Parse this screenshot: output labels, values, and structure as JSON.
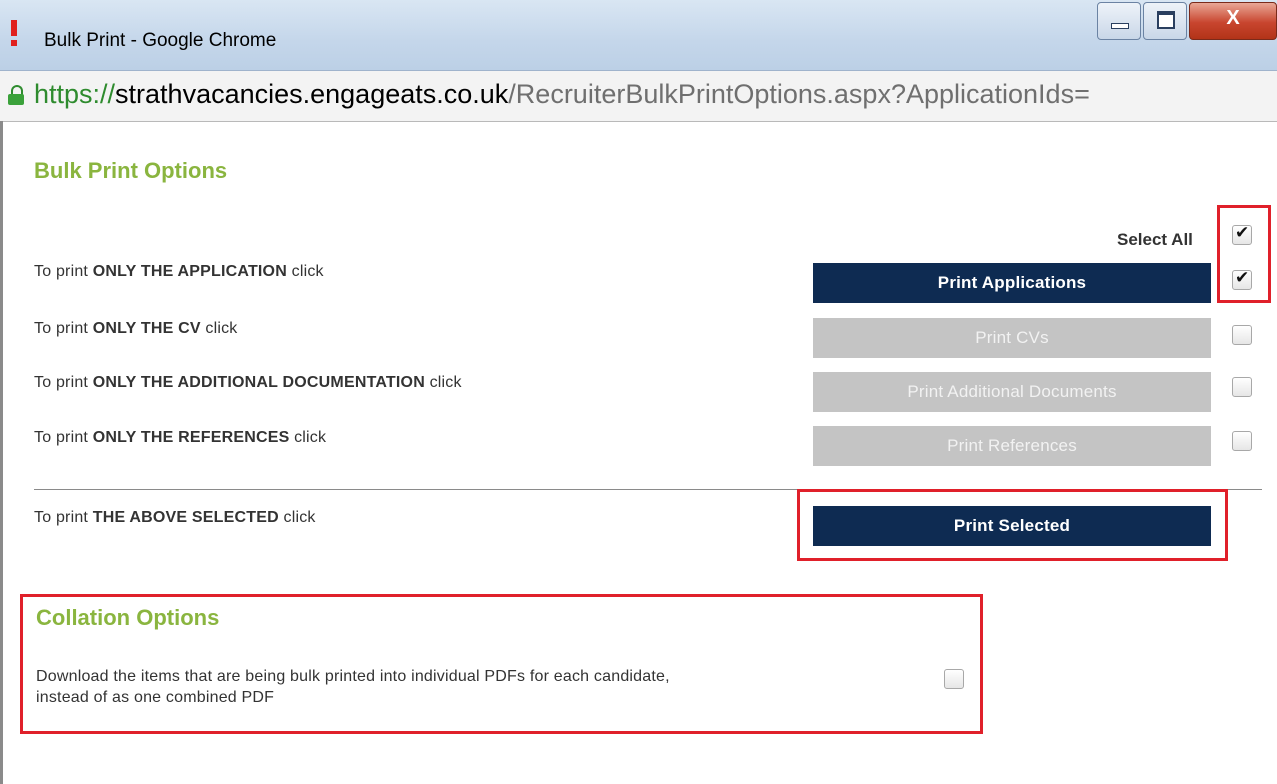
{
  "window": {
    "title": "Bulk Print - Google Chrome",
    "close_label": "X"
  },
  "address": {
    "protocol": "https://",
    "host": "strathvacancies.engageats.co.uk",
    "path": "/RecruiterBulkPrintOptions.aspx?ApplicationIds="
  },
  "colors": {
    "accent_green": "#8ab53f",
    "button_navy": "#0e2b52",
    "button_disabled": "#c4c4c4",
    "highlight_red": "#e0202a"
  },
  "bulk_print": {
    "heading": "Bulk Print Options",
    "select_all_label": "Select All",
    "select_all_checked": true,
    "rows": [
      {
        "prefix": "To print ",
        "strong": "ONLY THE APPLICATION",
        "suffix": " click",
        "button": "Print Applications",
        "enabled": true,
        "checked": true
      },
      {
        "prefix": "To print ",
        "strong": "ONLY THE CV",
        "suffix": " click",
        "button": "Print CVs",
        "enabled": false,
        "checked": false
      },
      {
        "prefix": "To print ",
        "strong": "ONLY THE ADDITIONAL DOCUMENTATION",
        "suffix": " click",
        "button": "Print Additional Documents",
        "enabled": false,
        "checked": false
      },
      {
        "prefix": "To print ",
        "strong": "ONLY THE REFERENCES",
        "suffix": " click",
        "button": "Print References",
        "enabled": false,
        "checked": false
      }
    ],
    "selected_row": {
      "prefix": "To print ",
      "strong": "THE ABOVE SELECTED",
      "suffix": " click",
      "button": "Print Selected"
    }
  },
  "collation": {
    "heading": "Collation Options",
    "line1": "Download the items that are being bulk printed into individual PDFs for each candidate,",
    "line2": "instead of as one combined PDF",
    "checked": false
  }
}
